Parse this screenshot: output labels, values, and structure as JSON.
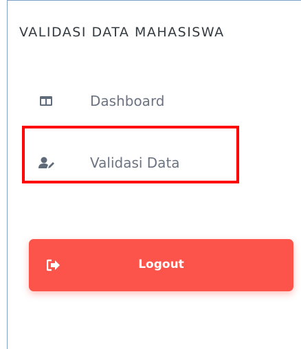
{
  "sidebar": {
    "title": "VALIDASI DATA MAHASISWA",
    "items": [
      {
        "label": "Dashboard",
        "icon": "columns-icon"
      },
      {
        "label": "Validasi Data",
        "icon": "user-edit-icon"
      }
    ],
    "highlight_color": "#ff0000",
    "logout": {
      "label": "Logout",
      "icon": "sign-out-icon",
      "color": "#fc544b"
    }
  }
}
